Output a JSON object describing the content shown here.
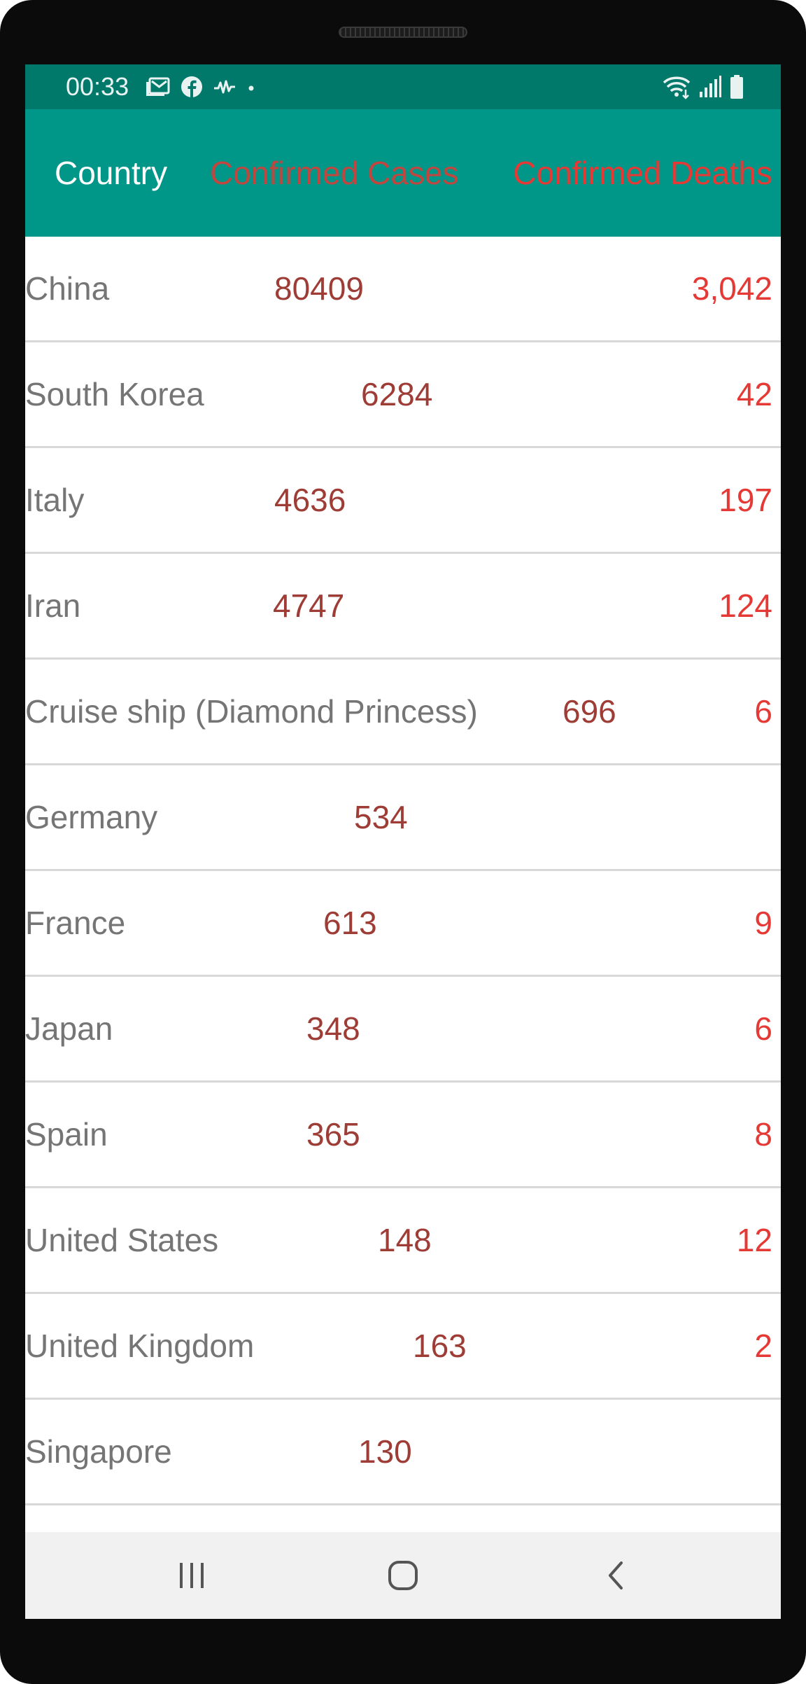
{
  "status_bar": {
    "time": "00:33",
    "left_icons": [
      "gmail-icon",
      "facebook-icon",
      "activity-icon",
      "dot-icon"
    ],
    "right_icons": [
      "wifi-icon",
      "signal-icon",
      "battery-icon"
    ]
  },
  "header": {
    "country_label": "Country",
    "cases_label": "Confirmed Cases",
    "deaths_label": "Confirmed Deaths"
  },
  "rows": [
    {
      "country": "China",
      "cases": "80409",
      "deaths": "3,042"
    },
    {
      "country": "South Korea",
      "cases": "6284",
      "deaths": "42"
    },
    {
      "country": "Italy",
      "cases": "4636",
      "deaths": "197"
    },
    {
      "country": "Iran",
      "cases": "4747",
      "deaths": "124"
    },
    {
      "country": "Cruise ship (Diamond Princess)",
      "cases": "696",
      "deaths": "6"
    },
    {
      "country": "Germany",
      "cases": "534",
      "deaths": ""
    },
    {
      "country": "France",
      "cases": "613",
      "deaths": "9"
    },
    {
      "country": "Japan",
      "cases": "348",
      "deaths": "6"
    },
    {
      "country": "Spain",
      "cases": "365",
      "deaths": "8"
    },
    {
      "country": "United States",
      "cases": "148",
      "deaths": "12"
    },
    {
      "country": "United Kingdom",
      "cases": "163",
      "deaths": "2"
    },
    {
      "country": "Singapore",
      "cases": "130",
      "deaths": ""
    }
  ],
  "nav": {
    "icons": [
      "recent-apps-icon",
      "home-icon",
      "back-icon"
    ]
  },
  "colors": {
    "status_bar": "#00796b",
    "header": "#009688",
    "cases_text": "#9e3c36",
    "deaths_text": "#e53935"
  }
}
